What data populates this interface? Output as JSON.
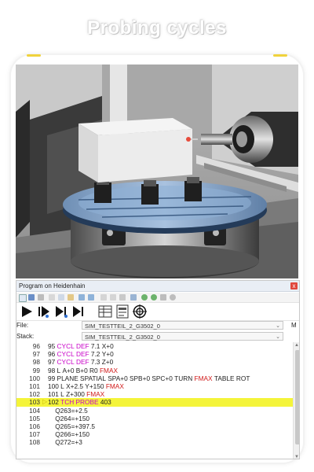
{
  "page_title": "Probing cycles",
  "panel": {
    "title": "Program on Heidenhain",
    "close_symbol": "x"
  },
  "fields": {
    "file_label": "File:",
    "file_value": "SIM_TESTTEIL_2_G3502_0",
    "stack_label": "Stack:",
    "stack_value": "SIM_TESTTEIL_2_G3502_0",
    "m_label": "M"
  },
  "toolbar_icons": [
    "start-icon",
    "single-step-icon",
    "step-forward-icon",
    "step-end-icon",
    "table-icon",
    "report-icon",
    "target-icon"
  ],
  "code_lines": [
    {
      "ln": "96",
      "parts": [
        {
          "t": "95 ",
          "c": ""
        },
        {
          "t": "CYCL DEF",
          "c": "kw"
        },
        {
          "t": " 7.1 X+0",
          "c": ""
        }
      ]
    },
    {
      "ln": "97",
      "parts": [
        {
          "t": "96 ",
          "c": ""
        },
        {
          "t": "CYCL DEF",
          "c": "kw"
        },
        {
          "t": " 7.2 Y+0",
          "c": ""
        }
      ]
    },
    {
      "ln": "98",
      "parts": [
        {
          "t": "97 ",
          "c": ""
        },
        {
          "t": "CYCL DEF",
          "c": "kw"
        },
        {
          "t": " 7.3 Z+0",
          "c": ""
        }
      ]
    },
    {
      "ln": "99",
      "parts": [
        {
          "t": "98 L A+0 B+0 R0 ",
          "c": ""
        },
        {
          "t": "FMAX",
          "c": "kw2"
        }
      ]
    },
    {
      "ln": "100",
      "parts": [
        {
          "t": "99 PLANE SPATIAL SPA+0 SPB+0 SPC+0 TURN ",
          "c": ""
        },
        {
          "t": "FMAX",
          "c": "kw2"
        },
        {
          "t": " TABLE ROT",
          "c": ""
        }
      ]
    },
    {
      "ln": "101",
      "parts": [
        {
          "t": "100 L X+2.5 Y+150 ",
          "c": ""
        },
        {
          "t": "FMAX",
          "c": "kw2"
        }
      ]
    },
    {
      "ln": "102",
      "parts": [
        {
          "t": "101 L Z+300 ",
          "c": ""
        },
        {
          "t": "FMAX",
          "c": "kw2"
        }
      ]
    },
    {
      "ln": "103",
      "active": true,
      "parts": [
        {
          "t": "102 ",
          "c": ""
        },
        {
          "t": "TCH PROBE",
          "c": "kw"
        },
        {
          "t": " 403",
          "c": ""
        }
      ]
    },
    {
      "ln": "104",
      "parts": [
        {
          "t": "    Q263=+2.5",
          "c": ""
        }
      ]
    },
    {
      "ln": "105",
      "parts": [
        {
          "t": "    Q264=+150",
          "c": ""
        }
      ]
    },
    {
      "ln": "106",
      "parts": [
        {
          "t": "    Q265=+397.5",
          "c": ""
        }
      ]
    },
    {
      "ln": "107",
      "parts": [
        {
          "t": "    Q266=+150",
          "c": ""
        }
      ]
    },
    {
      "ln": "108",
      "parts": [
        {
          "t": "    Q272=+3",
          "c": ""
        }
      ]
    }
  ],
  "colors": {
    "keyword": "#c800c8",
    "fmax": "#d01818",
    "highlight": "#f4f43a",
    "accent_dash": "#f0d23c"
  }
}
